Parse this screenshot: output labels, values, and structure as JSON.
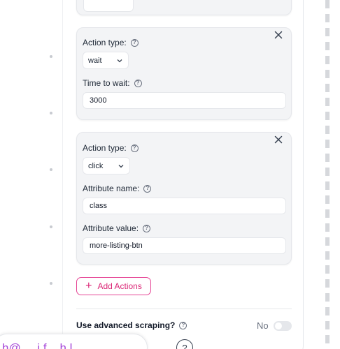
{
  "cards": [
    {
      "action_type_label": "Action type:",
      "action_type_value": "wait",
      "fields": [
        {
          "label": "Time to wait:",
          "value": "3000"
        }
      ]
    },
    {
      "action_type_label": "Action type:",
      "action_type_value": "click",
      "fields": [
        {
          "label": "Attribute name:",
          "value": "class"
        },
        {
          "label": "Attribute value:",
          "value": "more-listing-btn"
        }
      ]
    }
  ],
  "help_glyph": "?",
  "add_actions_label": "Add Actions",
  "advanced": {
    "label": "Use advanced scraping?",
    "state": "No"
  },
  "bubble_text": "h@ ... i.f... h.l..",
  "help_fab_label": "?",
  "colors": {
    "accent": "#db2777",
    "card_bg": "#f3f4f6",
    "border": "#e5e7eb",
    "bubble_text": "#a64ad8"
  },
  "icons": [
    "close-icon",
    "chevron-down-icon",
    "help-icon",
    "plus-icon",
    "question-icon"
  ]
}
